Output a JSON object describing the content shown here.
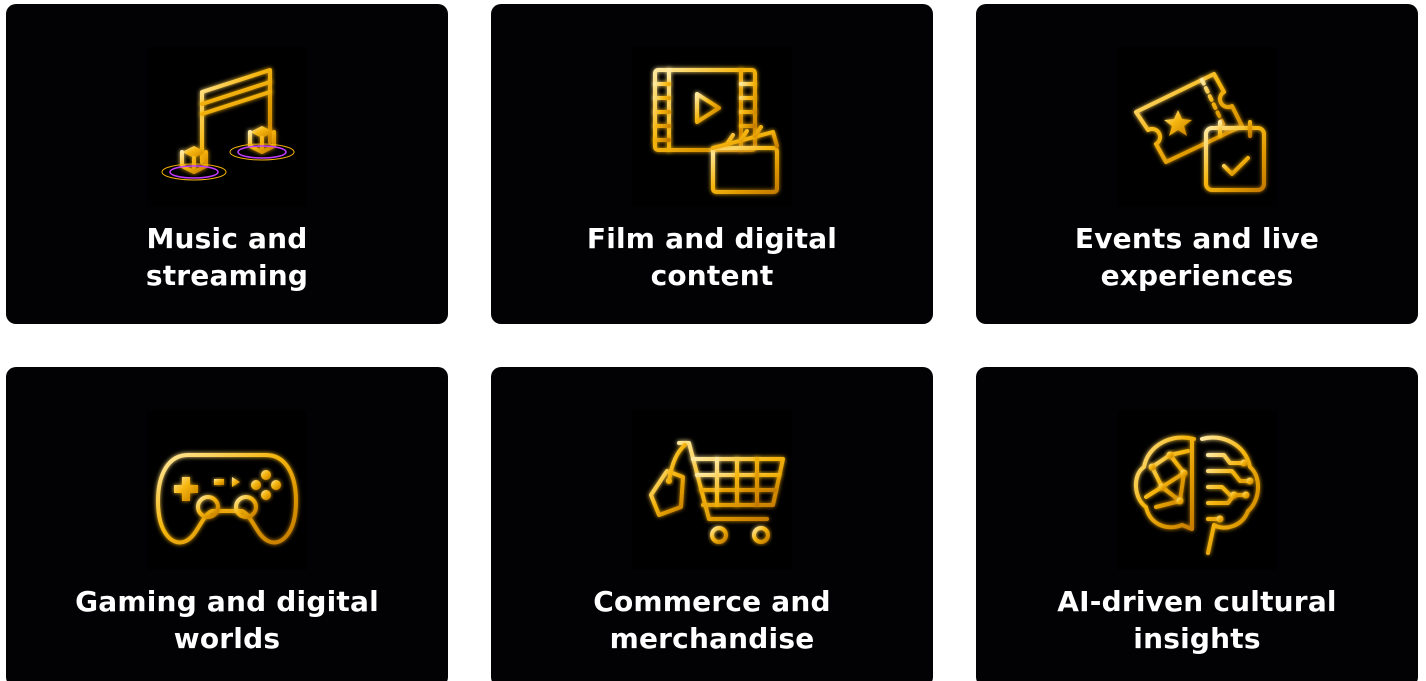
{
  "colors": {
    "card_background": "#020205",
    "page_background": "#ffffff",
    "label_text": "#ffffff",
    "icon_gold_light": "#ffe9a0",
    "icon_gold_mid": "#f5b40a",
    "icon_gold_dark": "#c47a00",
    "accent_purple": "#c23cff"
  },
  "cards": [
    {
      "label": "Music and streaming",
      "icon": "music-note-icon"
    },
    {
      "label": "Film and digital content",
      "icon": "film-clapperboard-icon"
    },
    {
      "label": "Events and live experiences",
      "icon": "ticket-calendar-icon"
    },
    {
      "label": "Gaming and digital worlds",
      "icon": "game-controller-icon"
    },
    {
      "label": "Commerce and merchandise",
      "icon": "shopping-cart-icon"
    },
    {
      "label": "AI-driven cultural insights",
      "icon": "ai-brain-icon"
    }
  ]
}
